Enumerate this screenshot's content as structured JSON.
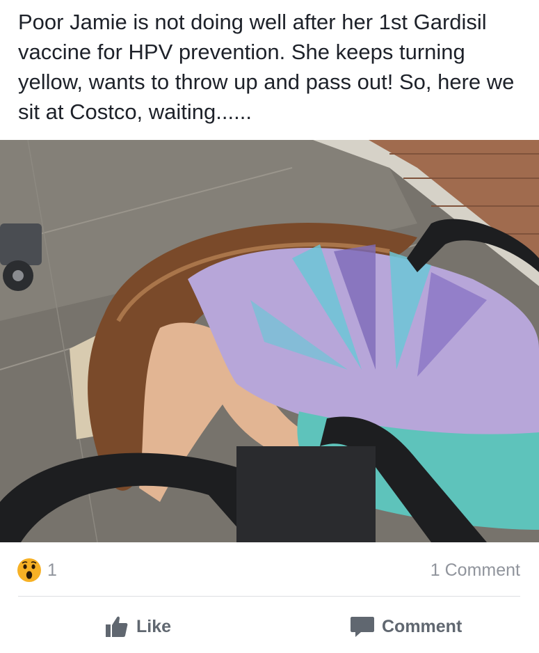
{
  "post": {
    "text": "Poor Jamie is not doing well after her 1st Gardisil vaccine for HPV prevention. She keeps turning yellow, wants to throw up and pass out! So, here we sit at Costco, waiting......"
  },
  "photo": {
    "icon": "photo"
  },
  "reactions": {
    "icon": "wow-emoji-icon",
    "count": "1",
    "color": "#f7b125"
  },
  "comments": {
    "count_label": "1 Comment"
  },
  "actions": {
    "like_label": "Like",
    "like_icon": "thumbs-up-icon",
    "comment_label": "Comment",
    "comment_icon": "speech-bubble-icon",
    "icon_color": "#606770"
  }
}
